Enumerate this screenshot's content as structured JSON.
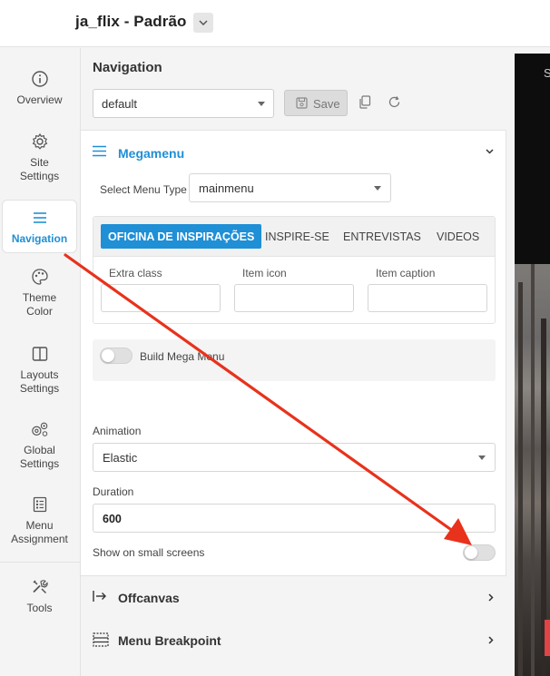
{
  "header": {
    "site_title": "ja_flix - Padrão"
  },
  "sidebar": {
    "items": [
      {
        "label1": "Overview",
        "label2": ""
      },
      {
        "label1": "Site",
        "label2": "Settings"
      },
      {
        "label1": "Navigation",
        "label2": ""
      },
      {
        "label1": "Theme",
        "label2": "Color"
      },
      {
        "label1": "Layouts",
        "label2": "Settings"
      },
      {
        "label1": "Global",
        "label2": "Settings"
      },
      {
        "label1": "Menu",
        "label2": "Assignment"
      },
      {
        "label1": "Tools",
        "label2": ""
      }
    ]
  },
  "panel": {
    "title": "Navigation",
    "preset_value": "default",
    "save_label": "Save",
    "megamenu": {
      "section_label": "Megamenu",
      "select_menu_type_label": "Select Menu Type",
      "menu_type_value": "mainmenu",
      "tabs": [
        "OFICINA DE INSPIRAÇÕES",
        "INSPIRE-SE",
        "ENTREVISTAS",
        "VIDEOS"
      ],
      "extra_class_label": "Extra class",
      "item_icon_label": "Item icon",
      "item_caption_label": "Item caption",
      "build_mega_menu_label": "Build Mega Menu"
    },
    "animation_label": "Animation",
    "animation_value": "Elastic",
    "duration_label": "Duration",
    "duration_value": "600",
    "small_screens_label": "Show on small screens",
    "offcanvas_label": "Offcanvas",
    "breakpoint_label": "Menu Breakpoint"
  },
  "preview": {
    "letter": "S"
  },
  "colors": {
    "accent": "#1f8fd6",
    "arrow": "#e8321c"
  },
  "icons": [
    "info-icon",
    "gear-icon",
    "hamburger-icon",
    "palette-icon",
    "layout-icon",
    "global-gears-icon",
    "list-icon",
    "tools-icon",
    "save-icon",
    "copy-icon",
    "refresh-icon",
    "chevron-down-icon",
    "chevron-right-icon",
    "offcanvas-icon",
    "breakpoint-icon"
  ]
}
